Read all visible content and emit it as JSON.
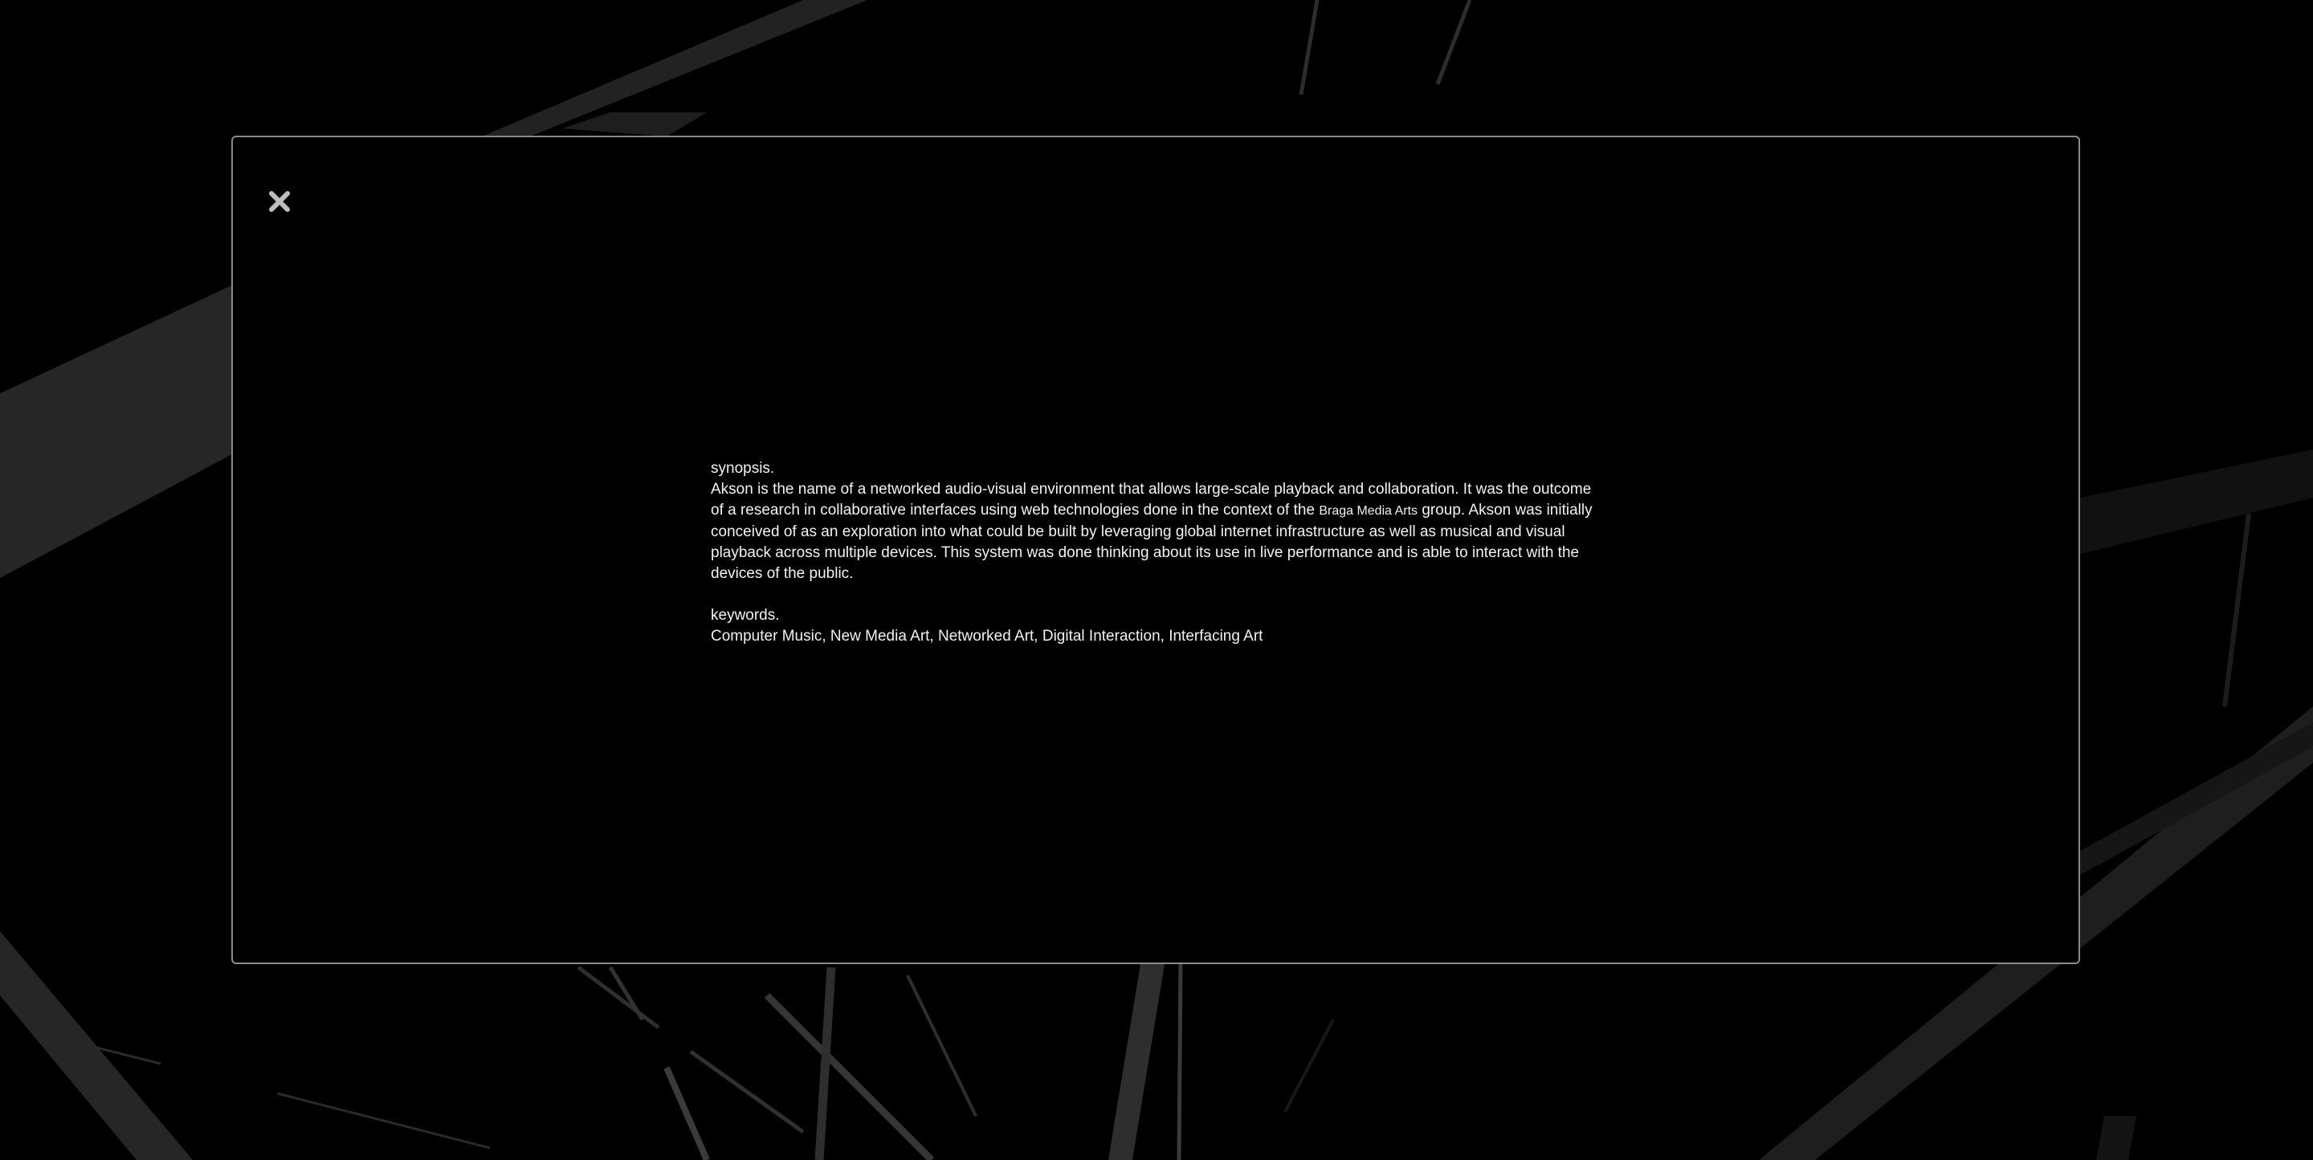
{
  "modal": {
    "close_icon": "close-icon",
    "close_color": "#bdbdbd",
    "border_color": "#8a8a8a"
  },
  "synopsis": {
    "heading": "synopsis.",
    "text_part1": "Akson is the name of a networked audio-visual environment that allows large-scale playback and collaboration. It was the outcome of a research in collaborative interfaces using web technologies done in the context of the ",
    "group_name": "Braga Media Arts",
    "text_part2": " group. Akson was initially conceived of as an exploration into what could be built by leveraging global internet infrastructure as well as musical and visual playback across multiple devices. This system was done thinking about its use in live performance and is able to interact with the devices of the public."
  },
  "keywords": {
    "heading": "keywords.",
    "list": "Computer Music, New Media Art, Networked Art, Digital Interaction, Interfacing Art"
  },
  "colors": {
    "background": "#000000",
    "text": "#f2f2f2",
    "shards": "#2a2a2a"
  }
}
